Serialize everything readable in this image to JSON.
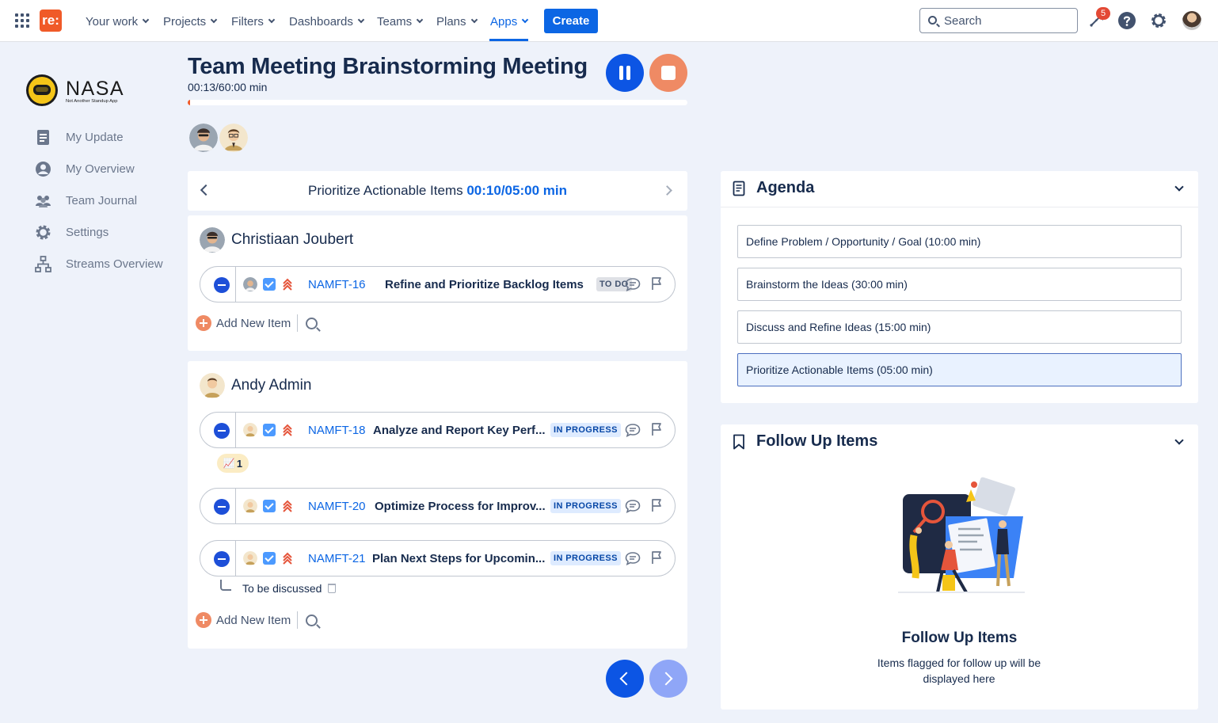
{
  "topnav": {
    "app_logo": "re:",
    "items": [
      {
        "label": "Your work"
      },
      {
        "label": "Projects"
      },
      {
        "label": "Filters"
      },
      {
        "label": "Dashboards"
      },
      {
        "label": "Teams"
      },
      {
        "label": "Plans"
      },
      {
        "label": "Apps"
      }
    ],
    "active_item": "Apps",
    "create_label": "Create",
    "search_placeholder": "Search",
    "notification_count": "5",
    "icons": [
      "app-grid-icon",
      "notification-icon",
      "help-icon",
      "settings-icon"
    ],
    "accent_color": "#0c66e4"
  },
  "sidebar": {
    "logo_text": "NASA",
    "logo_subtext": "Not Another Standup App",
    "items": [
      {
        "label": "My Update",
        "icon": "document-icon"
      },
      {
        "label": "My Overview",
        "icon": "user-circle-icon"
      },
      {
        "label": "Team Journal",
        "icon": "people-icon"
      },
      {
        "label": "Settings",
        "icon": "gear-icon"
      },
      {
        "label": "Streams Overview",
        "icon": "hierarchy-icon"
      }
    ]
  },
  "meeting": {
    "title": "Team Meeting Brainstorming Meeting",
    "time": "00:13/60:00 min",
    "progress": 0.004,
    "progress_color": "#f05a28",
    "participants": [
      "Christiaan Joubert",
      "Andy Admin"
    ]
  },
  "topic": {
    "name": "Prioritize Actionable Items",
    "time": "00:10/05:00 min"
  },
  "people": [
    {
      "name": "Christiaan Joubert",
      "issues": [
        {
          "key": "NAMFT-16",
          "summary": "Refine and Prioritize Backlog Items",
          "status": "TO DO"
        }
      ],
      "add_label": "Add New Item"
    },
    {
      "name": "Andy Admin",
      "issues": [
        {
          "key": "NAMFT-18",
          "summary": "Analyze and Report Key Perf...",
          "status": "IN PROGRESS",
          "reaction_emoji": "📈",
          "reaction_count": "1"
        },
        {
          "key": "NAMFT-20",
          "summary": "Optimize Process for Improv...",
          "status": "IN PROGRESS"
        },
        {
          "key": "NAMFT-21",
          "summary": "Plan Next Steps for Upcomin...",
          "status": "IN PROGRESS",
          "note": "To be discussed"
        }
      ],
      "add_label": "Add New Item"
    }
  ],
  "agenda": {
    "title": "Agenda",
    "items": [
      {
        "label": "Define Problem / Opportunity / Goal (10:00 min)"
      },
      {
        "label": "Brainstorm the Ideas (30:00 min)"
      },
      {
        "label": "Discuss and Refine Ideas (15:00 min)"
      },
      {
        "label": "Prioritize Actionable Items (05:00 min)",
        "current": true
      }
    ]
  },
  "followup": {
    "title": "Follow Up Items",
    "empty_title": "Follow Up Items",
    "empty_desc": "Items flagged for follow up will be displayed here"
  }
}
